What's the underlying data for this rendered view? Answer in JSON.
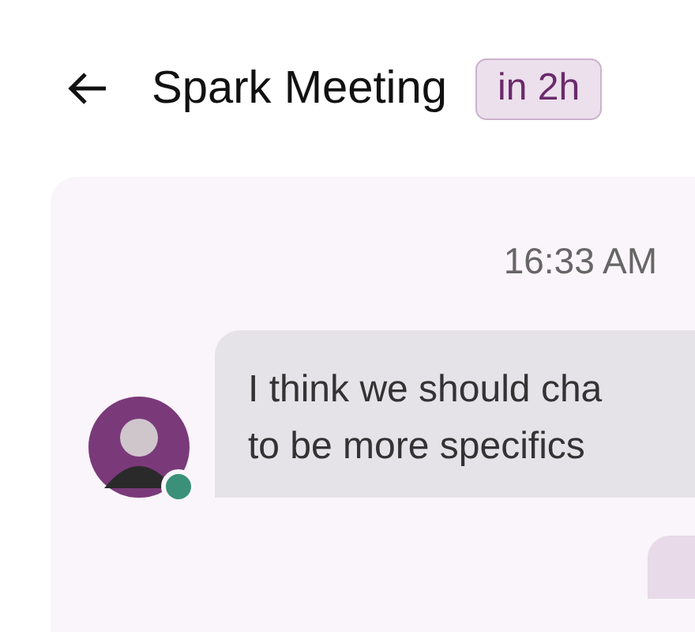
{
  "header": {
    "title": "Spark Meeting",
    "badge": "in 2h"
  },
  "chat": {
    "time": "16:33 AM",
    "messages": [
      {
        "kind": "incoming",
        "lines": [
          "I think we should cha",
          "to be more specifics"
        ],
        "online": true
      },
      {
        "kind": "outgoing"
      }
    ]
  }
}
